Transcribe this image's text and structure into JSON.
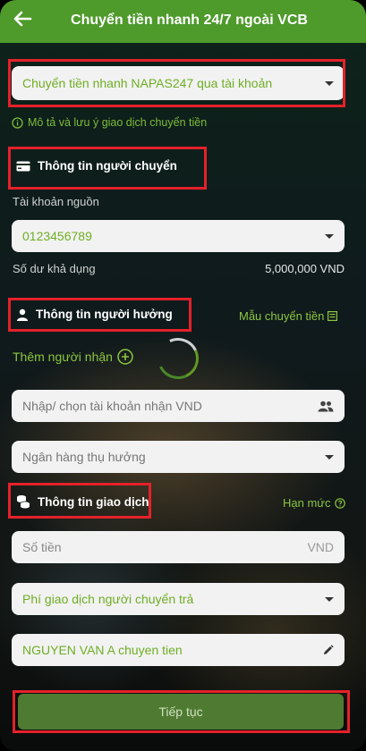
{
  "header": {
    "title": "Chuyển tiền nhanh 24/7 ngoài VCB"
  },
  "transfer_type": {
    "value": "Chuyển tiền nhanh NAPAS247 qua tài khoản"
  },
  "note": {
    "text": "Mô tả và lưu ý giao dịch chuyển tiền"
  },
  "sender": {
    "section_title": "Thông tin người chuyển",
    "source_label": "Tài khoản nguồn",
    "source_value": "0123456789",
    "balance_label": "Số dư khả dụng",
    "balance_value": "5,000,000 VND"
  },
  "receiver": {
    "section_title": "Thông tin người hưởng",
    "template_link": "Mẫu chuyển tiền",
    "add_receiver": "Thêm người nhận",
    "account_placeholder": "Nhập/ chọn tài khoản nhận VND",
    "bank_placeholder": "Ngân hàng thụ hưởng"
  },
  "transaction": {
    "section_title": "Thông tin giao dịch",
    "limit_link": "Hạn mức",
    "amount_placeholder": "Số tiền",
    "amount_currency": "VND",
    "fee_value": "Phí giao dịch người chuyển trả",
    "description_value": "NGUYEN VAN A chuyen tien"
  },
  "actions": {
    "continue_label": "Tiếp tục"
  },
  "colors": {
    "brand_green": "#4e9a2b",
    "accent_green": "#8cc63f",
    "highlight_red": "#e4212a"
  }
}
